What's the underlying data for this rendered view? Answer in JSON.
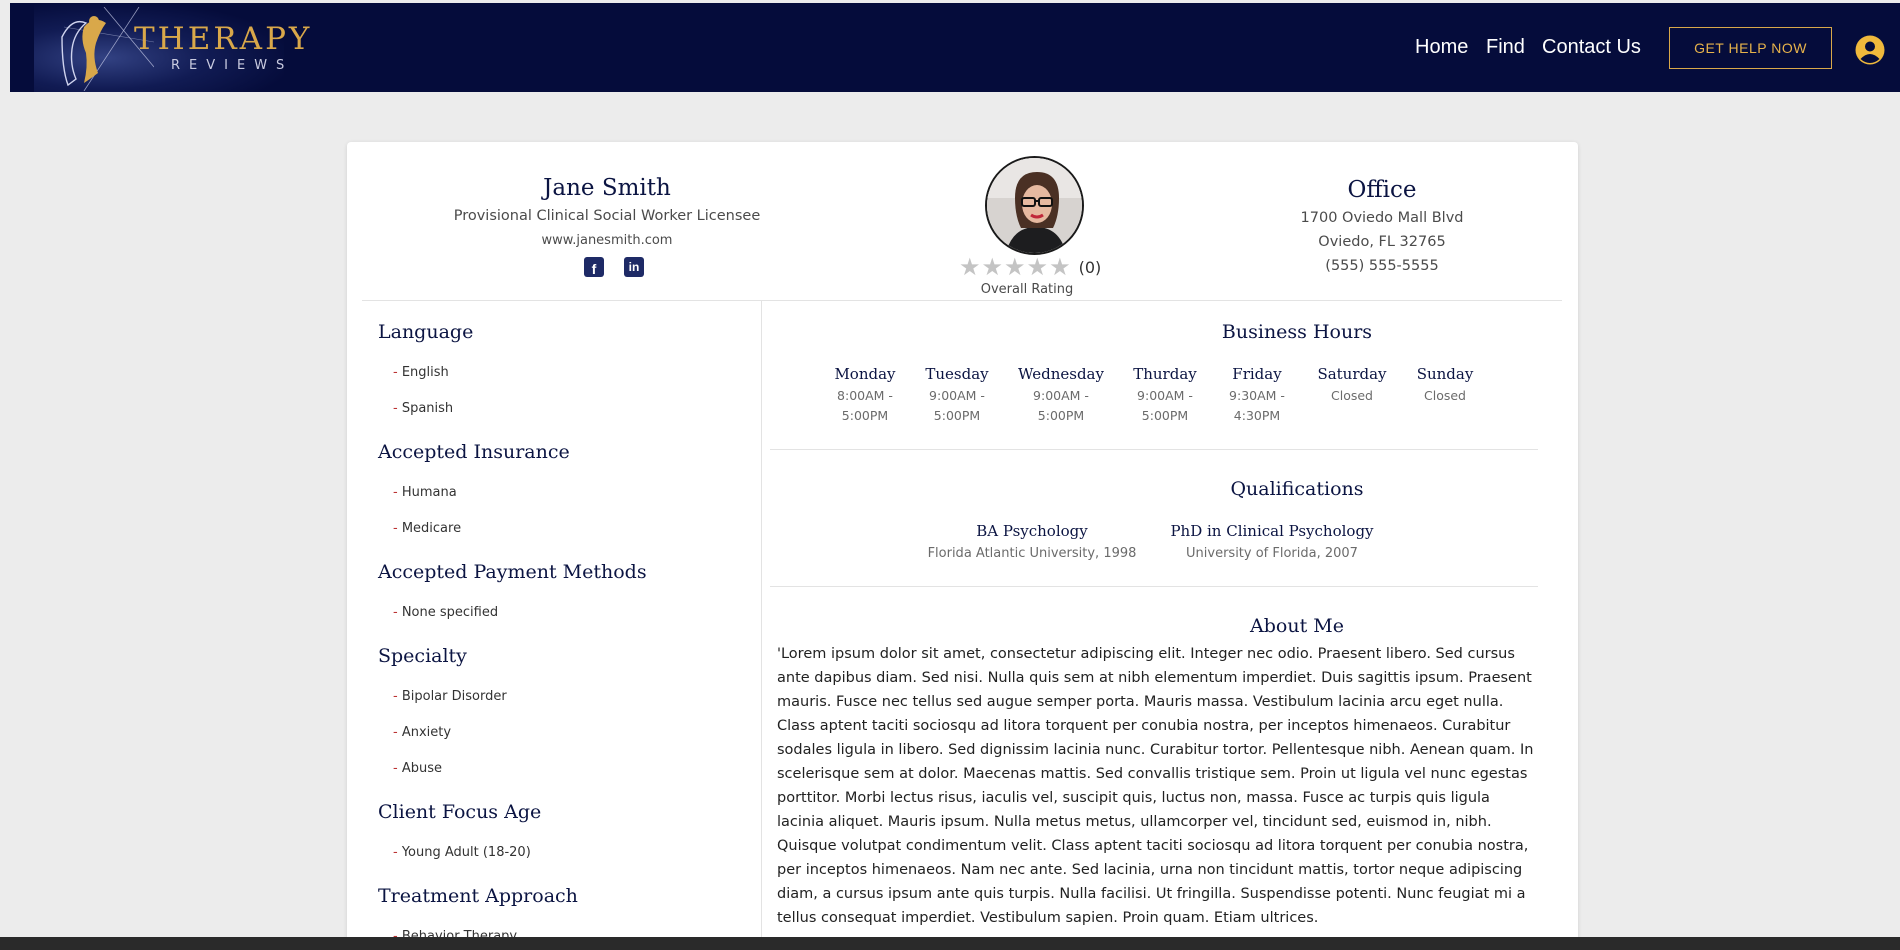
{
  "header": {
    "logo": {
      "line1": "THERAPY",
      "line2": "REVIEWS"
    },
    "nav": [
      {
        "label": "Home"
      },
      {
        "label": "Find"
      },
      {
        "label": "Contact Us"
      }
    ],
    "cta_label": "GET HELP NOW",
    "account_icon": "user-circle-icon",
    "colors": {
      "navbar": "#050c3b",
      "accent": "#e7b34b"
    }
  },
  "profile": {
    "name": "Jane Smith",
    "title": "Provisional Clinical Social Worker Licensee",
    "website": "www.janesmith.com",
    "social": [
      {
        "icon": "facebook-icon",
        "glyph": "f"
      },
      {
        "icon": "linkedin-icon",
        "glyph": "in"
      }
    ],
    "rating": {
      "stars": 0,
      "max": 5,
      "count": "(0)",
      "label": "Overall Rating"
    }
  },
  "office": {
    "title": "Office",
    "address1": "1700 Oviedo Mall Blvd",
    "address2": "Oviedo, FL 32765",
    "phone": "(555) 555-5555"
  },
  "sidebar": {
    "sections": [
      {
        "title": "Language",
        "items": [
          "English",
          "Spanish"
        ]
      },
      {
        "title": "Accepted Insurance",
        "items": [
          "Humana",
          "Medicare"
        ]
      },
      {
        "title": "Accepted Payment Methods",
        "items": [
          "None specified"
        ]
      },
      {
        "title": "Specialty",
        "items": [
          "Bipolar Disorder",
          "Anxiety",
          "Abuse"
        ]
      },
      {
        "title": "Client Focus Age",
        "items": [
          "Young Adult (18-20)"
        ]
      },
      {
        "title": "Treatment Approach",
        "items": [
          "Behavior Therapy"
        ]
      }
    ]
  },
  "hours": {
    "title": "Business Hours",
    "days": [
      {
        "day": "Monday",
        "line1": "8:00AM -",
        "line2": "5:00PM"
      },
      {
        "day": "Tuesday",
        "line1": "9:00AM -",
        "line2": "5:00PM"
      },
      {
        "day": "Wednesday",
        "line1": "9:00AM -",
        "line2": "5:00PM"
      },
      {
        "day": "Thurday",
        "line1": "9:00AM -",
        "line2": "5:00PM"
      },
      {
        "day": "Friday",
        "line1": "9:30AM -",
        "line2": "4:30PM"
      },
      {
        "day": "Saturday",
        "line1": "Closed",
        "line2": ""
      },
      {
        "day": "Sunday",
        "line1": "Closed",
        "line2": ""
      }
    ]
  },
  "qualifications": {
    "title": "Qualifications",
    "items": [
      {
        "degree": "BA Psychology",
        "school": "Florida Atlantic University, 1998"
      },
      {
        "degree": "PhD in Clinical Psychology",
        "school": "University of Florida, 2007"
      }
    ]
  },
  "about": {
    "title": "About Me",
    "text": "'Lorem ipsum dolor sit amet, consectetur adipiscing elit. Integer nec odio. Praesent libero. Sed cursus ante dapibus diam. Sed nisi. Nulla quis sem at nibh elementum imperdiet. Duis sagittis ipsum. Praesent mauris. Fusce nec tellus sed augue semper porta. Mauris massa. Vestibulum lacinia arcu eget nulla. Class aptent taciti sociosqu ad litora torquent per conubia nostra, per inceptos himenaeos. Curabitur sodales ligula in libero. Sed dignissim lacinia nunc. Curabitur tortor. Pellentesque nibh. Aenean quam. In scelerisque sem at dolor. Maecenas mattis. Sed convallis tristique sem. Proin ut ligula vel nunc egestas porttitor. Morbi lectus risus, iaculis vel, suscipit quis, luctus non, massa. Fusce ac turpis quis ligula lacinia aliquet. Mauris ipsum. Nulla metus metus, ullamcorper vel, tincidunt sed, euismod in, nibh. Quisque volutpat condimentum velit. Class aptent taciti sociosqu ad litora torquent per conubia nostra, per inceptos himenaeos. Nam nec ante. Sed lacinia, urna non tincidunt mattis, tortor neque adipiscing diam, a cursus ipsum ante quis turpis. Nulla facilisi. Ut fringilla. Suspendisse potenti. Nunc feugiat mi a tellus consequat imperdiet. Vestibulum sapien. Proin quam. Etiam ultrices."
  }
}
